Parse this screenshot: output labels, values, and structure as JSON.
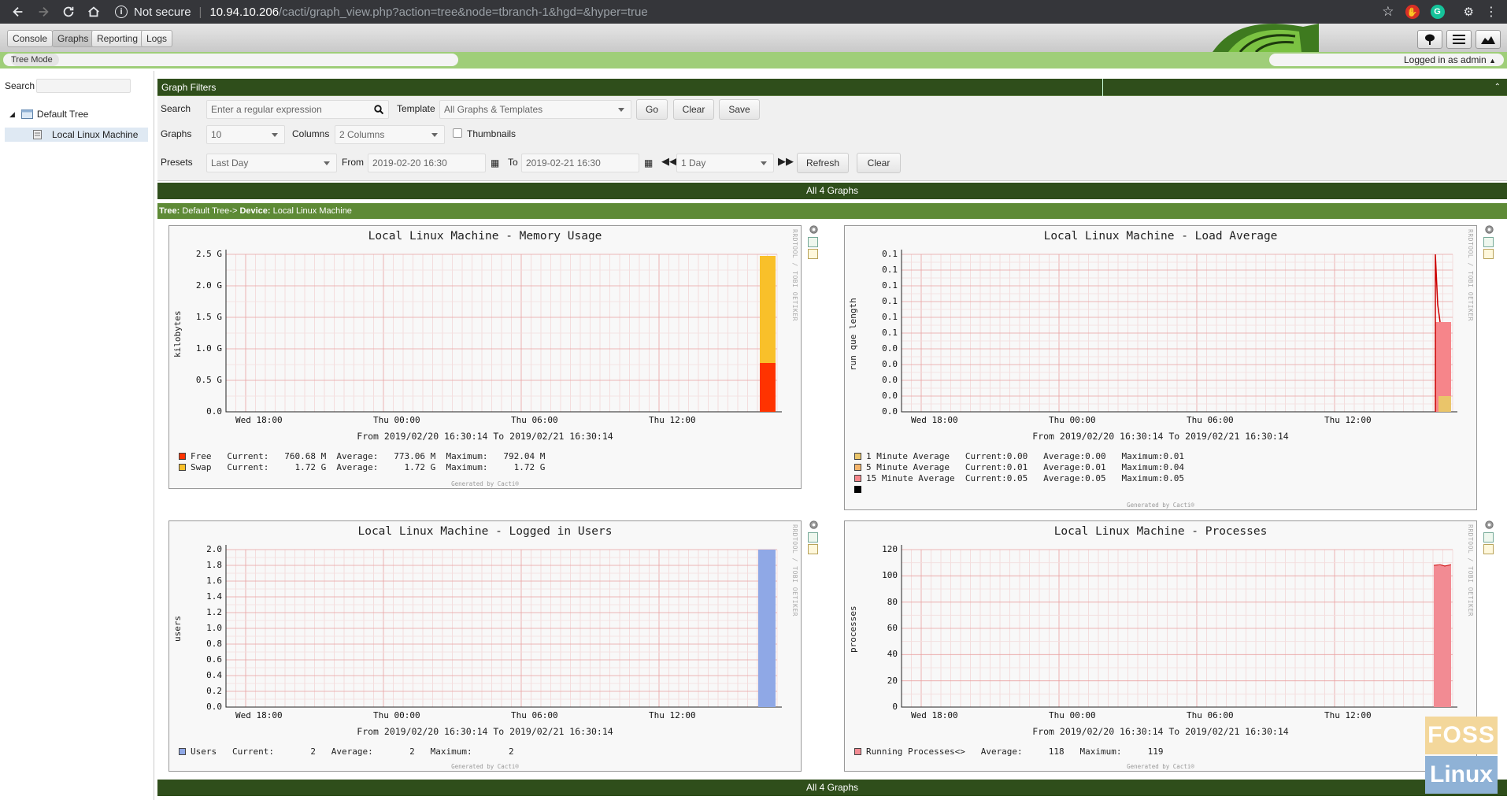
{
  "browser": {
    "security": "Not secure",
    "url_host": "10.94.10.206",
    "url_path": "/cacti/graph_view.php?action=tree&node=tbranch-1&hgd=&hyper=true"
  },
  "tabs": [
    "Console",
    "Graphs",
    "Reporting",
    "Logs"
  ],
  "tree_mode": "Tree Mode",
  "logged_in": "Logged in as admin",
  "sidebar": {
    "search_label": "Search",
    "tree_root": "Default Tree",
    "tree_node": "Local Linux Machine"
  },
  "filters": {
    "header": "Graph Filters",
    "search_label": "Search",
    "search_placeholder": "Enter a regular expression",
    "template_label": "Template",
    "template_value": "All Graphs & Templates",
    "go": "Go",
    "clear": "Clear",
    "save": "Save",
    "graphs_label": "Graphs",
    "graphs_value": "10",
    "columns_label": "Columns",
    "columns_value": "2 Columns",
    "thumbnails_label": "Thumbnails",
    "presets_label": "Presets",
    "presets_value": "Last Day",
    "from_label": "From",
    "from_value": "2019-02-20 16:30",
    "to_label": "To",
    "to_value": "2019-02-21 16:30",
    "shift_value": "1 Day",
    "refresh": "Refresh",
    "clear2": "Clear"
  },
  "all_graphs": "All 4 Graphs",
  "breadcrumb": {
    "tree_label": "Tree:",
    "tree_value": "Default Tree->",
    "device_label": "Device:",
    "device_value": "Local Linux Machine"
  },
  "common": {
    "x_ticks": [
      "Wed 18:00",
      "Thu 00:00",
      "Thu 06:00",
      "Thu 12:00"
    ],
    "range": "From 2019/02/20 16:30:14 To 2019/02/21 16:30:14",
    "generated": "Generated by Cacti®",
    "rrd": "RRDTOOL / TOBI OETIKER"
  },
  "graphs": [
    {
      "title": "Local Linux Machine - Memory Usage",
      "ylabel": "kilobytes",
      "yticks": [
        "2.5 G",
        "2.0 G",
        "1.5 G",
        "1.0 G",
        "0.5 G",
        "0.0"
      ],
      "legend": [
        {
          "name": "Free",
          "color": "#ff3300",
          "text": "Free   Current:   760.68 M  Average:   773.06 M  Maximum:   792.04 M"
        },
        {
          "name": "Swap",
          "color": "#f9c02a",
          "text": "Swap   Current:     1.72 G  Average:     1.72 G  Maximum:     1.72 G"
        }
      ]
    },
    {
      "title": "Local Linux Machine - Load Average",
      "ylabel": "run que length",
      "yticks": [
        "0.1",
        "0.1",
        "0.1",
        "0.1",
        "0.1",
        "0.1",
        "0.0",
        "0.0",
        "0.0",
        "0.0",
        "0.0"
      ],
      "legend": [
        {
          "name": "1 Minute Average",
          "color": "#eac56a",
          "text": "1 Minute Average   Current:0.00   Average:0.00   Maximum:0.01"
        },
        {
          "name": "5 Minute Average",
          "color": "#f5b56b",
          "text": "5 Minute Average   Current:0.01   Average:0.01   Maximum:0.04"
        },
        {
          "name": "15 Minute Average",
          "color": "#f6858a",
          "text": "15 Minute Average  Current:0.05   Average:0.05   Maximum:0.05"
        }
      ]
    },
    {
      "title": "Local Linux Machine - Logged in Users",
      "ylabel": "users",
      "yticks": [
        "2.0",
        "1.8",
        "1.6",
        "1.4",
        "1.2",
        "1.0",
        "0.8",
        "0.6",
        "0.4",
        "0.2",
        "0.0"
      ],
      "legend": [
        {
          "name": "Users",
          "color": "#8fa8e6",
          "text": "Users   Current:       2   Average:       2   Maximum:       2"
        }
      ]
    },
    {
      "title": "Local Linux Machine - Processes",
      "ylabel": "processes",
      "yticks": [
        "120",
        "100",
        "80",
        "60",
        "40",
        "20",
        "0"
      ],
      "legend": [
        {
          "name": "Running Processes",
          "color": "#f28b93",
          "text": "Running Processes<>   Average:     118   Maximum:     119"
        }
      ]
    }
  ],
  "watermark": {
    "top": "FOSS",
    "bottom": "Linux"
  }
}
